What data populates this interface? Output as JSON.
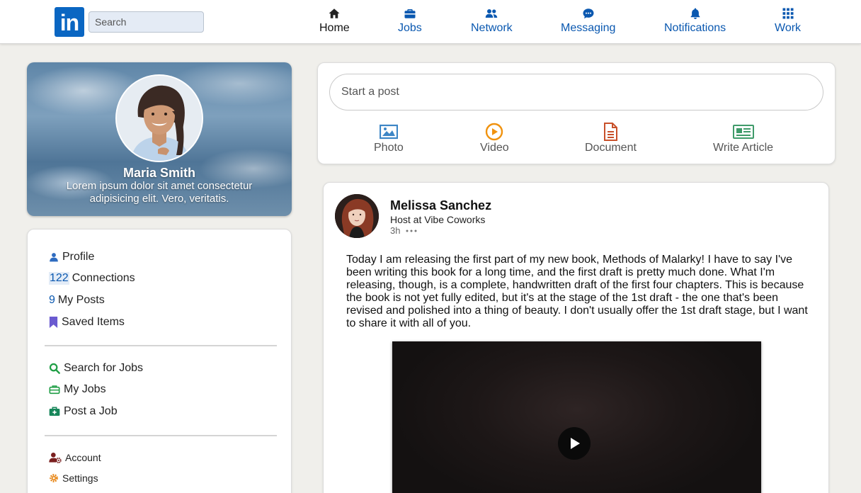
{
  "header": {
    "logo_text": "in",
    "search": {
      "placeholder": "Search",
      "value": ""
    },
    "nav": [
      {
        "label": "Home",
        "icon": "home-icon"
      },
      {
        "label": "Jobs",
        "icon": "briefcase-icon"
      },
      {
        "label": "Network",
        "icon": "people-icon"
      },
      {
        "label": "Messaging",
        "icon": "chat-icon"
      },
      {
        "label": "Notifications",
        "icon": "bell-icon"
      },
      {
        "label": "Work",
        "icon": "grid-icon"
      }
    ],
    "active_nav": "Home"
  },
  "profile": {
    "name": "Maria Smith",
    "bio": "Lorem ipsum dolor sit amet consectetur adipisicing elit. Vero, veritatis."
  },
  "menu": {
    "profile_label": "Profile",
    "connections_count": "122",
    "connections_label": "Connections",
    "posts_count": "9",
    "posts_label": "My Posts",
    "saved_label": "Saved Items",
    "search_jobs_label": "Search for Jobs",
    "my_jobs_label": "My Jobs",
    "post_job_label": "Post a Job",
    "account_label": "Account",
    "settings_label": "Settings"
  },
  "composer": {
    "placeholder": "Start a post",
    "actions": [
      {
        "label": "Photo",
        "icon": "photo-icon",
        "color": "#3d86c6"
      },
      {
        "label": "Video",
        "icon": "video-play-icon",
        "color": "#f0920e"
      },
      {
        "label": "Document",
        "icon": "document-icon",
        "color": "#c8502a"
      },
      {
        "label": "Write Article",
        "icon": "article-icon",
        "color": "#3f9b6a"
      }
    ]
  },
  "post": {
    "author": "Melissa Sanchez",
    "title": "Host at Vibe Coworks",
    "time": "3h",
    "text": "Today I am releasing the first part of my new book, Methods of Malarky! I have to say I've been writing this book for a long time, and the first draft is pretty much done. What I'm releasing, though, is a complete, handwritten draft of the first four chapters. This is because the book is not yet fully edited, but it's at the stage of the 1st draft - the one that's been revised and polished into a thing of beauty. I don't usually offer the 1st draft stage, but I want to share it with all of you."
  },
  "colors": {
    "brand": "#0a66c2",
    "nav_text": "#0a58b0",
    "page_bg": "#f0efeb"
  }
}
